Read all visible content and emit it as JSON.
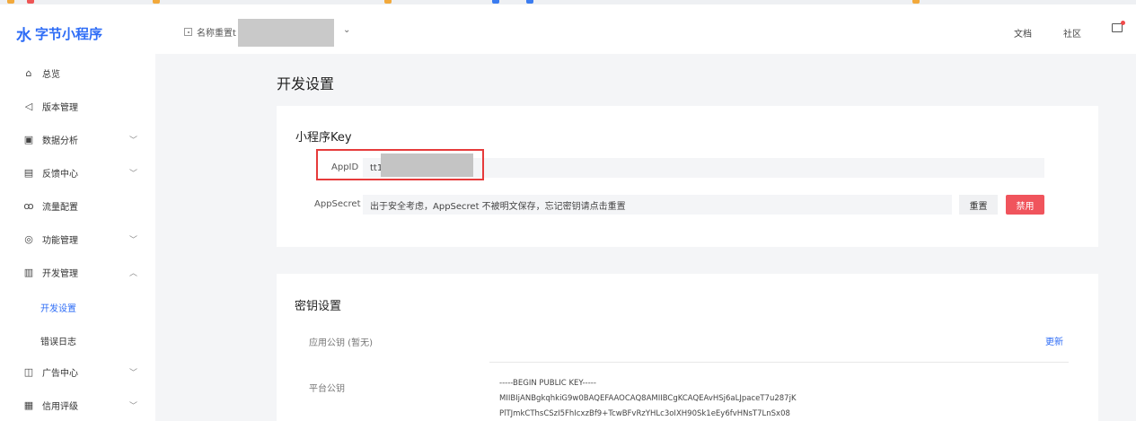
{
  "header": {
    "logo_glyph": "水",
    "logo_text": "字节小程序",
    "app_name": "名称重置t",
    "top_links": {
      "docs": "文档",
      "community": "社区"
    }
  },
  "sidebar": {
    "items": [
      {
        "icon": "home-icon",
        "glyph": "⌂",
        "label": "总览"
      },
      {
        "icon": "send-icon",
        "glyph": "◁",
        "label": "版本管理"
      },
      {
        "icon": "chart-icon",
        "glyph": "▣",
        "label": "数据分析",
        "chevron": "﹀"
      },
      {
        "icon": "feedback-icon",
        "glyph": "▤",
        "label": "反馈中心",
        "chevron": "﹀"
      },
      {
        "icon": "traffic-icon",
        "glyph": "ꝏ",
        "label": "流量配置"
      },
      {
        "icon": "feature-icon",
        "glyph": "◎",
        "label": "功能管理",
        "chevron": "﹀"
      },
      {
        "icon": "dev-icon",
        "glyph": "▥",
        "label": "开发管理",
        "chevron": "︿"
      },
      {
        "icon": "ad-icon",
        "glyph": "◫",
        "label": "广告中心",
        "chevron": "﹀"
      },
      {
        "icon": "credit-icon",
        "glyph": "▦",
        "label": "信用评级",
        "chevron": "﹀"
      }
    ],
    "sub_items": [
      {
        "label": "开发设置",
        "active": true
      },
      {
        "label": "错误日志",
        "active": false
      }
    ],
    "accent_color": "#2d6cf6"
  },
  "main": {
    "page_title": "开发设置",
    "key_card": {
      "title": "小程序Key",
      "appid_label": "AppID",
      "appid_value": "tt1",
      "appsecret_label": "AppSecret",
      "appsecret_value": "出于安全考虑，AppSecret 不被明文保存，忘记密钥请点击重置",
      "reset_button": "重置",
      "disable_button": "禁用",
      "disable_color": "#f0545c"
    },
    "secret_card": {
      "title": "密钥设置",
      "app_public_key_label": "应用公钥 (暂无)",
      "update_link": "更新",
      "platform_public_key_label": "平台公钥",
      "platform_public_key_lines": [
        "-----BEGIN PUBLIC KEY-----",
        "MIIBIjANBgkqhkiG9w0BAQEFAAOCAQ8AMIIBCgKCAQEAvHSj6aLJpaceT7u287jK",
        "PlTJmkCThsCSzI5FhIcxzBf9+TcwBFvRzYHLc3oIXH90Sk1eEy6fvHNsT7LnSx08"
      ]
    }
  }
}
